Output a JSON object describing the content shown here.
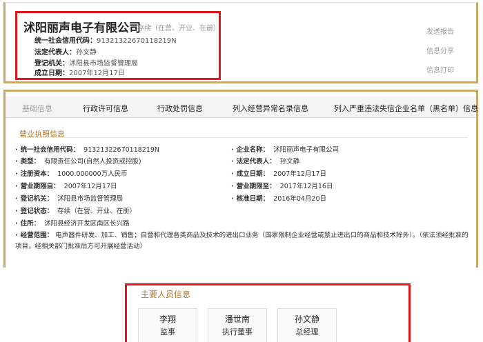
{
  "header": {
    "company_name": "沭阳丽声电子有限公司",
    "status": "存续（在营、开业、在册）",
    "credit_code_label": "统一社会信用代码：",
    "credit_code": "91321322670118219N",
    "legal_rep_label": "法定代表人：",
    "legal_rep": "孙文静",
    "authority_label": "登记机关：",
    "authority": "沭阳县市场监督管理局",
    "founded_label": "成立日期：",
    "founded": "2007年12月17日",
    "actions": [
      "发送报告",
      "信息分享",
      "信息打印"
    ]
  },
  "tabs": [
    "基础信息",
    "行政许可信息",
    "行政处罚信息",
    "列入经营异常名录信息",
    "列入严重违法失信企业名单（黑名单）信息"
  ],
  "license": {
    "title": "营业执照信息",
    "left": [
      {
        "label": "统一社会信用代码：",
        "value": "91321322670118219N"
      },
      {
        "label": "类型：",
        "value": "有限责任公司(自然人投资或控股)"
      },
      {
        "label": "注册资本：",
        "value": "1000.000000万人民币"
      },
      {
        "label": "营业期限自：",
        "value": "2007年12月17日"
      },
      {
        "label": "登记机关：",
        "value": "沭阳县市场监督管理局"
      },
      {
        "label": "登记状态：",
        "value": "存续（在营、开业、在册）"
      },
      {
        "label": "住所：",
        "value": "沭阳县经济开发区南区长兴路"
      }
    ],
    "right": [
      {
        "label": "企业名称：",
        "value": "沭阳丽声电子有限公司"
      },
      {
        "label": "法定代表人：",
        "value": "孙文静"
      },
      {
        "label": "成立日期：",
        "value": "2007年12月17日"
      },
      {
        "label": "营业期限至：",
        "value": "2017年12月16日"
      },
      {
        "label": "核准日期：",
        "value": "2016年04月20日"
      }
    ],
    "scope_label": "经营范围：",
    "scope": "电声器件研发、加工、销售；自营和代理各类商品及技术的进出口业务（国家限制企业经营或禁止进出口的商品和技术除外）。（依法须经批准的项目，经相关部门批准后方可开展经营活动）"
  },
  "personnel": {
    "title": "主要人员信息",
    "people": [
      {
        "name": "李翔",
        "role": "监事"
      },
      {
        "name": "潘世南",
        "role": "执行董事"
      },
      {
        "name": "孙文静",
        "role": "总经理"
      }
    ]
  },
  "colors": {
    "accent": "#c8a86a",
    "highlight": "#e0141a",
    "title": "#b5762b"
  }
}
